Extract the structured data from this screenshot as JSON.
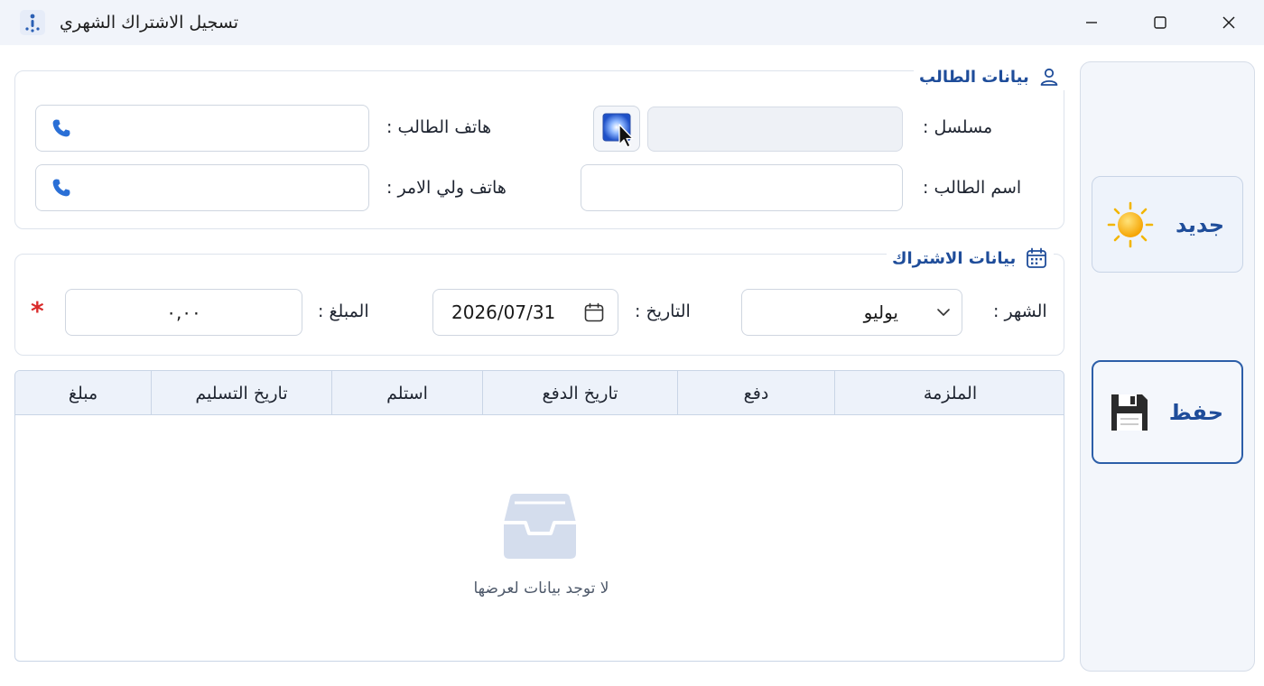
{
  "window": {
    "title": "تسجيل الاشتراك الشهري"
  },
  "student_group": {
    "title": "بيانات الطالب",
    "serial_label": "مسلسل :",
    "serial_value": "",
    "student_name_label": "اسم الطالب :",
    "student_name_value": "",
    "student_phone_label": "هاتف الطالب :",
    "student_phone_value": "",
    "guardian_phone_label": "هاتف ولي الامر :",
    "guardian_phone_value": ""
  },
  "subscription_group": {
    "title": "بيانات الاشتراك",
    "month_label": "الشهر :",
    "month_value": "يوليو",
    "date_label": "التاريخ :",
    "date_value": "2026/07/31",
    "amount_label": "المبلغ :",
    "amount_value": "٠,٠٠",
    "required_mark": "*"
  },
  "grid": {
    "columns": [
      "الملزمة",
      "دفع",
      "تاريخ الدفع",
      "استلم",
      "تاريخ التسليم",
      "مبلغ"
    ],
    "rows": [],
    "empty_text": "لا توجد بيانات لعرضها"
  },
  "side_panel": {
    "new_label": "جديد",
    "save_label": "حفظ"
  },
  "colors": {
    "accent": "#1f4d9a",
    "required": "#d92b2b",
    "phone_icon": "#2a6fd6"
  }
}
